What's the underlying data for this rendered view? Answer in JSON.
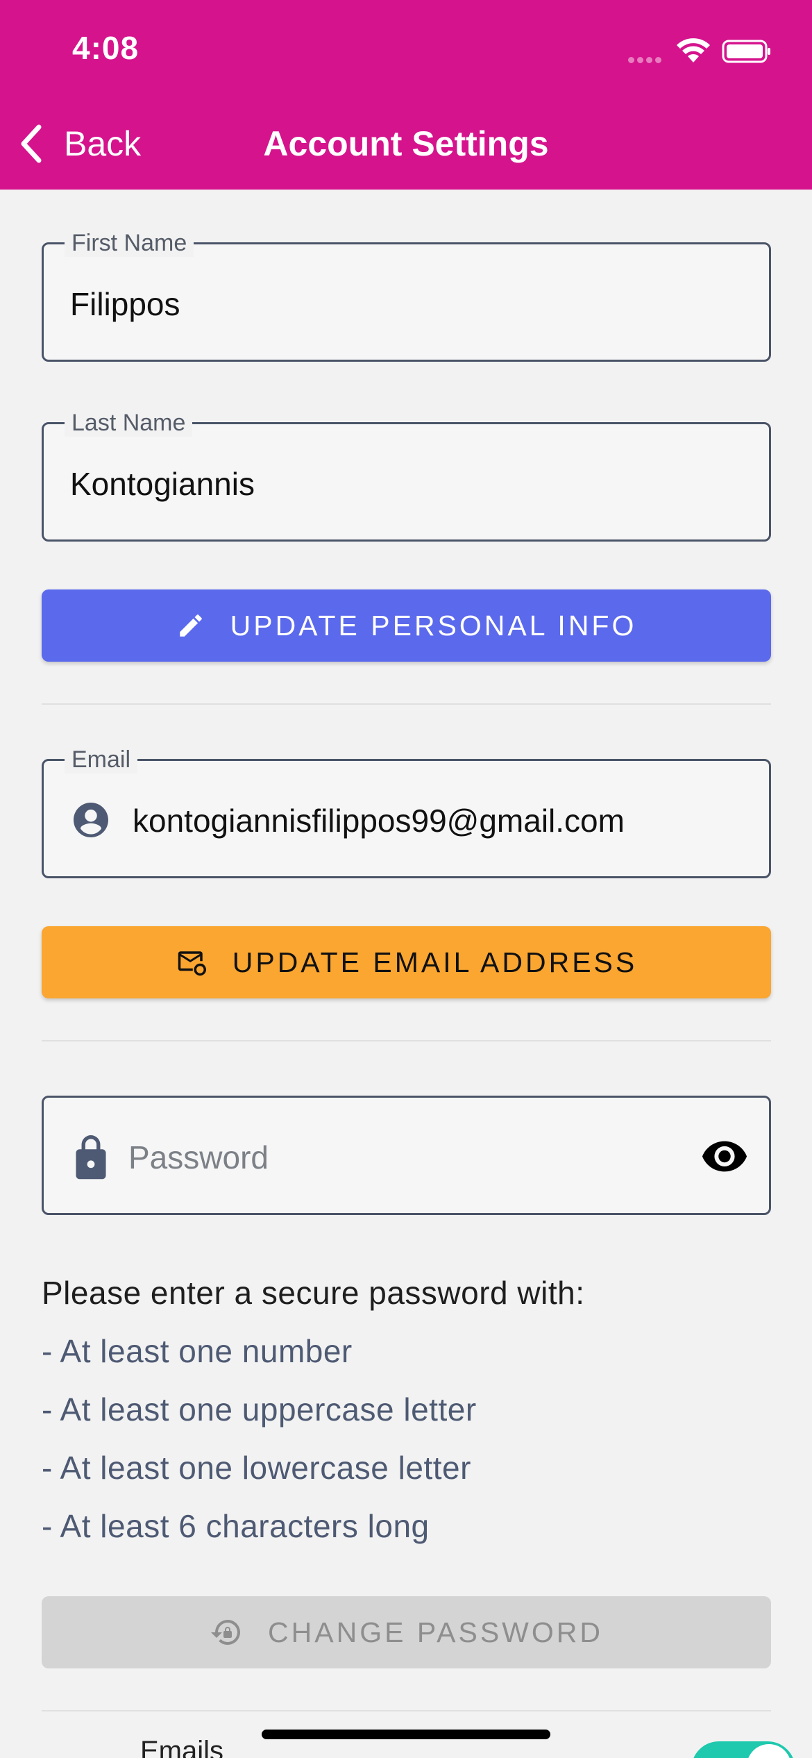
{
  "status_bar": {
    "time": "4:08"
  },
  "nav": {
    "back_label": "Back",
    "title": "Account Settings"
  },
  "personal": {
    "first_name": {
      "label": "First Name",
      "value": "Filippos"
    },
    "last_name": {
      "label": "Last Name",
      "value": "Kontogiannis"
    },
    "update_button": "UPDATE PERSONAL INFO"
  },
  "email": {
    "label": "Email",
    "value": "kontogiannisfilippos99@gmail.com",
    "update_button": "UPDATE EMAIL ADDRESS"
  },
  "password": {
    "placeholder": "Password",
    "requirements_intro": "Please enter a secure password with:",
    "requirements": [
      "- At least one number",
      "- At least one uppercase letter",
      "- At least one lowercase letter",
      "- At least 6 characters long"
    ],
    "change_button": "CHANGE PASSWORD",
    "change_button_enabled": false
  },
  "notifications": {
    "emails_label": "Emails",
    "emails_enabled": true
  },
  "colors": {
    "header": "#d5138d",
    "primary_button": "#5b69ec",
    "email_button": "#faa631",
    "disabled_button": "#d4d4d4",
    "toggle_on": "#1ec9ae"
  },
  "icons": {
    "back": "chevron-left-icon",
    "edit": "pencil-icon",
    "user": "account-circle-icon",
    "email_update": "mail-sync-icon",
    "lock": "lock-icon",
    "visibility": "eye-icon",
    "change_password": "lock-reset-icon"
  }
}
